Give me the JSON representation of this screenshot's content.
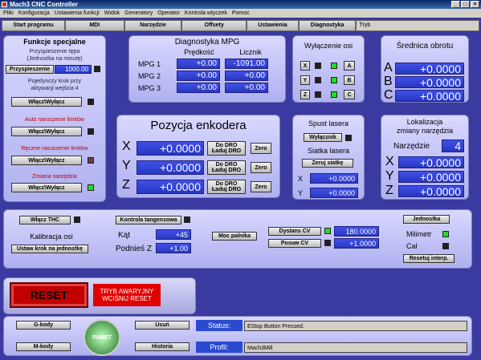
{
  "window": {
    "title": "Mach3 CNC Controller"
  },
  "menu": [
    "Pliki",
    "Konfiguracja",
    "Ustawienia funkcji",
    "Widok",
    "Generatory",
    "Operator",
    "Kontrola wtyczek",
    "Pomoc"
  ],
  "tabs": [
    "Start programu",
    "MDI",
    "Narzędzie",
    "Offsety",
    "Ustawienia",
    "Diagnostyka"
  ],
  "mode_field": "Tryb",
  "special": {
    "title": "Funkcje specjalne",
    "accel_caption_1": "Przyspieszenie tępa",
    "accel_caption_2": "(Jednostka na minutę)",
    "accel_label": "Przyspieszenie",
    "accel_value": "1000.00",
    "step_caption_1": "Pojedynczy krok przy",
    "step_caption_2": "aktywacji wejścia 4",
    "toggle": "Włącz\\Wyłącz",
    "auto_limits": "Auto naruszenie limitów",
    "manual_limits": "Ręczne naruszenie limitów",
    "tool_change": "Zmiana narzędzia"
  },
  "mpg": {
    "title": "Diagnostyka MPG",
    "col_speed": "Prędkość",
    "col_counter": "Licznik",
    "rows": [
      {
        "label": "MPG 1",
        "speed": "+0.00",
        "counter": "-1091.00"
      },
      {
        "label": "MPG 2",
        "speed": "+0.00",
        "counter": "+0.00"
      },
      {
        "label": "MPG 3",
        "speed": "+0.00",
        "counter": "+0.00"
      }
    ]
  },
  "axes_off": {
    "title": "Wyłączenie osi",
    "left": [
      "X",
      "Y",
      "Z"
    ],
    "right": [
      "A",
      "B",
      "C"
    ]
  },
  "diameter": {
    "title": "Średnica obrotu",
    "rows": [
      {
        "axis": "A",
        "value": "+0.0000"
      },
      {
        "axis": "B",
        "value": "+0.0000"
      },
      {
        "axis": "C",
        "value": "+0.0000"
      }
    ]
  },
  "encoder": {
    "title": "Pozycja enkodera",
    "rows": [
      {
        "axis": "X",
        "value": "+0.0000"
      },
      {
        "axis": "Y",
        "value": "+0.0000"
      },
      {
        "axis": "Z",
        "value": "+0.0000"
      }
    ],
    "to_dro": "Do DRO",
    "load_dro": "Ładuj DRO",
    "zero": "Zero"
  },
  "laser": {
    "title": "Spust lasera",
    "switch": "Wyłącznik",
    "grid_title": "Siatka lasera",
    "zero_grid": "Zeruj siatkę",
    "rows": [
      {
        "axis": "X",
        "value": "+0.0000"
      },
      {
        "axis": "Y",
        "value": "+0.0000"
      }
    ]
  },
  "tool_loc": {
    "title_1": "Lokalizacja",
    "title_2": "zmiany narzędzia",
    "tool_label": "Narzędzie",
    "tool_value": "4",
    "rows": [
      {
        "axis": "X",
        "value": "+0.0000"
      },
      {
        "axis": "Y",
        "value": "+0.0000"
      },
      {
        "axis": "Z",
        "value": "+0.0000"
      }
    ]
  },
  "thc": {
    "enable": "Włącz THC",
    "calib": "Kalibracja osi",
    "set_step": "Ustaw krok na jednostkę",
    "tangent": "Kontrola tangensowa",
    "angle_label": "Kąt",
    "angle_value": "+45",
    "lift_label": "Podnieś Z",
    "lift_value": "+1.00",
    "torch_power": "Moc palnika",
    "cv_dist": "Dystans CV",
    "cv_dist_value": "180.0000",
    "cv_feed": "Posuw CV",
    "cv_feed_value": "+1.0000",
    "unit": "Jednostka",
    "mm": "Milimetr",
    "inch": "Cal",
    "reset_interp": "Resetuj interp."
  },
  "reset": {
    "label": "RESET",
    "warn_1": "TRYB AWARYJNY",
    "warn_2": "WCIŚNIJ RESET"
  },
  "footer": {
    "gcodes": "G-kody",
    "mcodes": "M-kody",
    "logo": "PAMET",
    "delete": "Usuń",
    "history": "Historia",
    "status_label": "Status:",
    "status_value": "EStop Button Pressed.",
    "profile_label": "Profil:",
    "profile_value": "Mach3Mill"
  }
}
